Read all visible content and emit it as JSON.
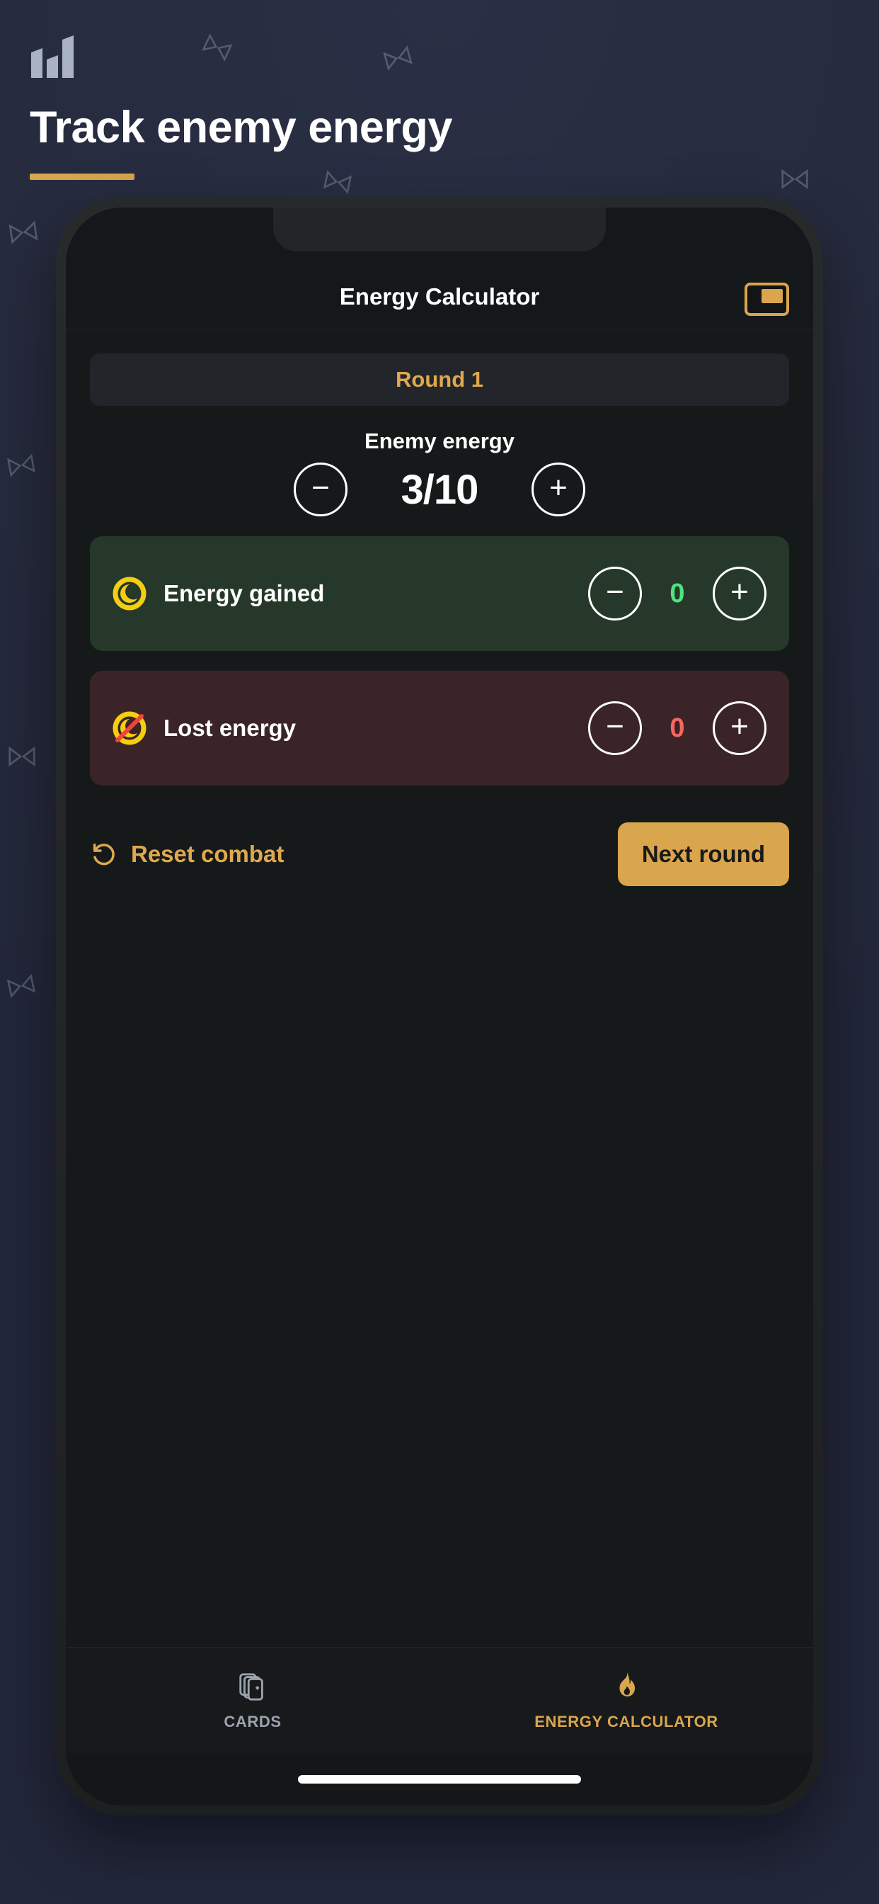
{
  "hero": {
    "icon": "bar-chart-icon",
    "title": "Track enemy energy",
    "accent_color": "#d9a54d"
  },
  "background": {
    "color_top": "#2a3048",
    "color_bottom": "#222739",
    "decor_glyph": "bowtie-outline"
  },
  "phone": {
    "header": {
      "title": "Energy Calculator",
      "pip_icon": "picture-in-picture-icon"
    },
    "round": {
      "label": "Round 1",
      "color": "#e0a84e"
    },
    "enemy_energy": {
      "label": "Enemy energy",
      "value": "3/10",
      "decrement_label": "−",
      "increment_label": "+"
    },
    "stats": [
      {
        "key": "energy-gained",
        "icon": "energy-swirl-icon",
        "label": "Energy gained",
        "value": "0",
        "value_color": "#4ee37f",
        "card_color": "#26382a",
        "decrement_label": "−",
        "increment_label": "+"
      },
      {
        "key": "lost-energy",
        "icon": "energy-swirl-struck-icon",
        "label": "Lost energy",
        "value": "0",
        "value_color": "#f9655f",
        "card_color": "#3b2427",
        "decrement_label": "−",
        "increment_label": "+"
      }
    ],
    "actions": {
      "reset_label": "Reset combat",
      "reset_icon": "rotate-ccw-icon",
      "next_label": "Next round",
      "next_color": "#d9a54d"
    },
    "tabs": [
      {
        "key": "cards",
        "label": "CARDS",
        "icon": "cards-stack-icon",
        "active": false,
        "color": "#9aa3ae"
      },
      {
        "key": "energy-calculator",
        "label": "ENERGY CALCULATOR",
        "icon": "flame-icon",
        "active": true,
        "color": "#d9a54d"
      }
    ]
  }
}
